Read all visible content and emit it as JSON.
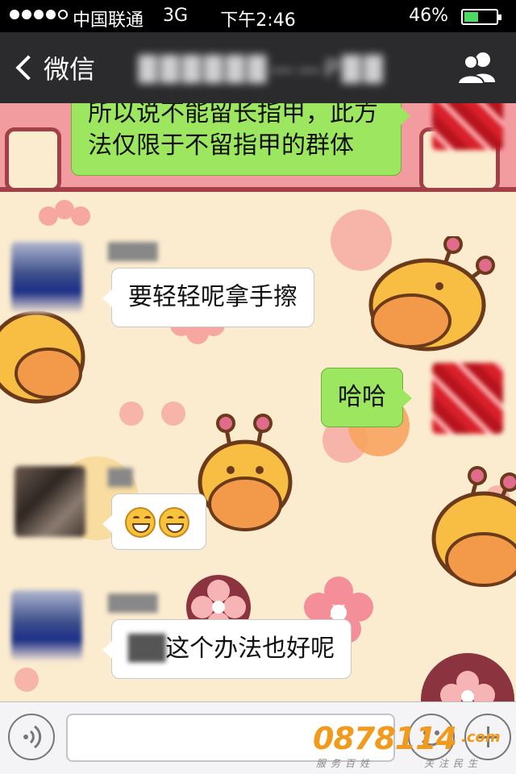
{
  "status_bar": {
    "carrier": "中国联通",
    "network": "3G",
    "time": "下午2:46",
    "battery_percent_text": "46%",
    "battery_level": 0.46,
    "signal_bars": 4
  },
  "nav": {
    "back_label": "微信",
    "title": "██████——P██",
    "right_icon": "group-members-icon"
  },
  "messages": [
    {
      "direction": "out",
      "text": "所以说不能留长指甲，此方法仅限于不留指甲的群体"
    },
    {
      "direction": "in",
      "sender": "████",
      "text": "要轻轻呢拿手擦"
    },
    {
      "direction": "out",
      "text": "哈哈"
    },
    {
      "direction": "in",
      "sender": "██",
      "emoji": [
        "grin-emoji",
        "grin-emoji"
      ]
    },
    {
      "direction": "in",
      "sender": "████",
      "prefix_blurred": "██",
      "text": "这个办法也好呢"
    }
  ],
  "input_bar": {
    "voice_icon": "voice-icon",
    "emoji_icon": "emoji-icon",
    "add_icon": "plus-icon"
  },
  "watermark": {
    "number": "0878114",
    "domain": ".com",
    "left_caption": "服务百姓",
    "right_caption": "关注民生"
  },
  "colors": {
    "nav_bg": "#2b2b2d",
    "outgoing_bubble": "#9de65f",
    "incoming_bubble": "#ffffff",
    "chat_bg": "#fbeccf",
    "battery_fill": "#4cd964"
  }
}
